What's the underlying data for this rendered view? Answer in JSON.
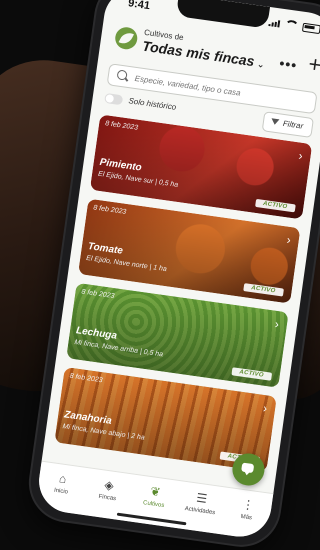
{
  "status_bar": {
    "time": "9:41"
  },
  "header": {
    "farm_label": "Cultivos de",
    "farm_selector": "Todas mis fincas"
  },
  "search": {
    "placeholder": "Especie, variedad, tipo o casa"
  },
  "filters": {
    "history_toggle_label": "Solo histórico",
    "history_toggle_on": false,
    "filter_button_label": "Filtrar"
  },
  "crops": [
    {
      "date": "8 feb 2023",
      "name": "Pimiento",
      "location": "El Ejido, Nave sur",
      "area": "0,5 ha",
      "status": "ACTIVO"
    },
    {
      "date": "8 feb 2023",
      "name": "Tomate",
      "location": "El Ejido, Nave norte",
      "area": "1 ha",
      "status": "ACTIVO"
    },
    {
      "date": "8 feb 2023",
      "name": "Lechuga",
      "location": "Mi finca, Nave arriba",
      "area": "0,5 ha",
      "status": "ACTIVO"
    },
    {
      "date": "8 feb 2023",
      "name": "Zanahoria",
      "location": "Mi finca, Nave abajo",
      "area": "2 ha",
      "status": "ACTIVO"
    }
  ],
  "crops_loc_text": [
    "El Ejido, Nave sur | 0,5 ha",
    "El Ejido, Nave norte | 1 ha",
    "Mi finca, Nave arriba | 0,5 ha",
    "Mi finca, Nave abajo | 2 ha"
  ],
  "bottom_nav": [
    {
      "label": "Inicio",
      "icon": "home-icon",
      "active": false
    },
    {
      "label": "Fincas",
      "icon": "fields-icon",
      "active": false
    },
    {
      "label": "Cultivos",
      "icon": "sprout-icon",
      "active": true
    },
    {
      "label": "Actividades",
      "icon": "checklist-icon",
      "active": false
    },
    {
      "label": "Más",
      "icon": "more-vertical-icon",
      "active": false
    }
  ],
  "colors": {
    "accent": "#5b8a2e",
    "status_text": "#5d8c2e"
  }
}
